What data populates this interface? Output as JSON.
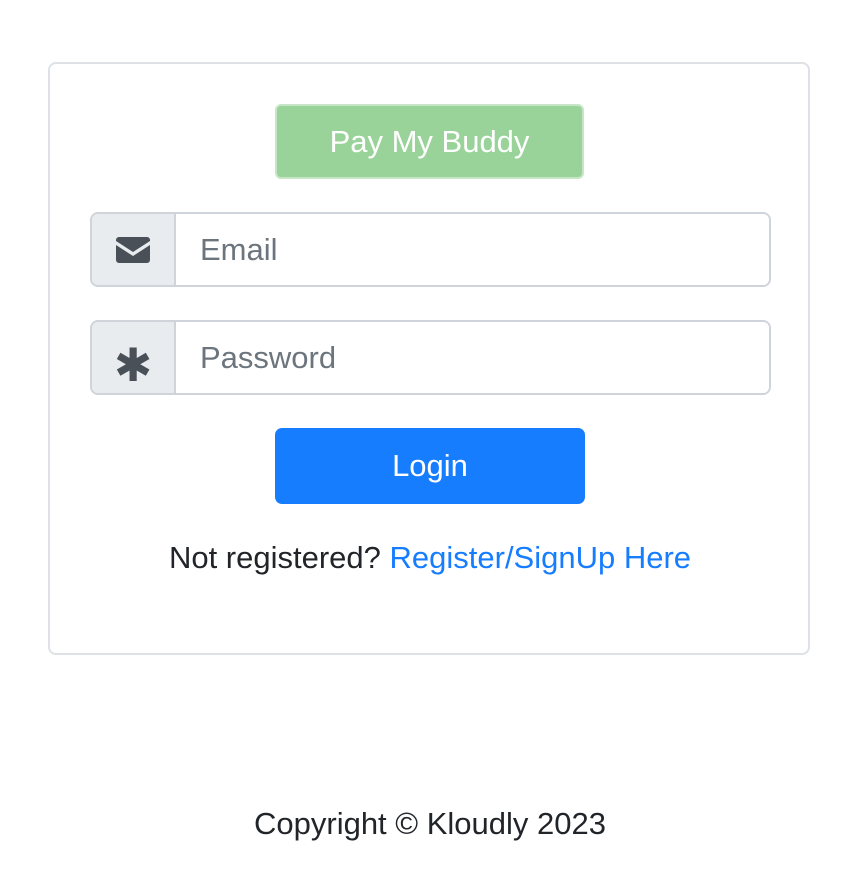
{
  "app": {
    "brand_button_label": "Pay My Buddy"
  },
  "form": {
    "email": {
      "icon": "envelope-icon",
      "placeholder": "Email",
      "value": ""
    },
    "password": {
      "icon": "asterisk-icon",
      "placeholder": "Password",
      "value": ""
    },
    "login_label": "Login",
    "register_prompt": "Not registered?",
    "register_link": "Register/SignUp Here"
  },
  "footer": {
    "copyright": "Copyright © Kloudly 2023"
  },
  "colors": {
    "brand_green": "#99d399",
    "primary_blue": "#177dff",
    "addon_gray": "#e9ecef",
    "border_gray": "#dee2e6"
  }
}
